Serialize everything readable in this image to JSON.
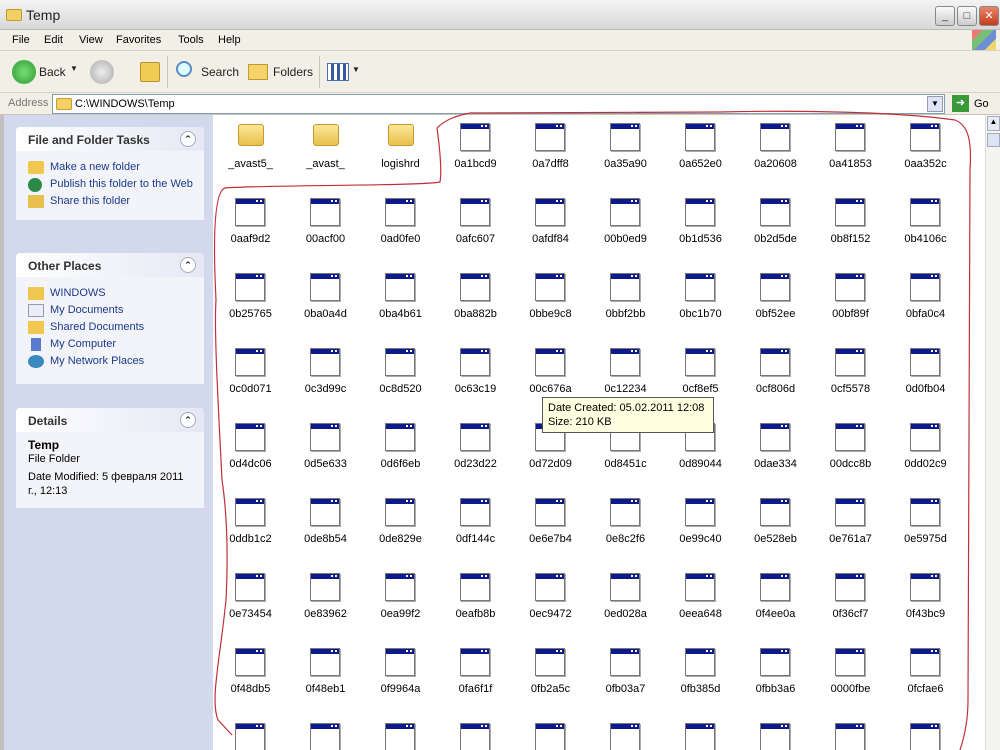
{
  "window": {
    "title": "Temp"
  },
  "menu": [
    "File",
    "Edit",
    "View",
    "Favorites",
    "Tools",
    "Help"
  ],
  "toolbar": {
    "back": "Back",
    "search": "Search",
    "folders": "Folders"
  },
  "address": {
    "label": "Address",
    "value": "C:\\WINDOWS\\Temp",
    "go": "Go"
  },
  "sidebar": {
    "tasks": {
      "title": "File and Folder Tasks",
      "items": [
        "Make a new folder",
        "Publish this folder to the Web",
        "Share this folder"
      ]
    },
    "places": {
      "title": "Other Places",
      "items": [
        "WINDOWS",
        "My Documents",
        "Shared Documents",
        "My Computer",
        "My Network Places"
      ]
    },
    "details": {
      "title": "Details",
      "name": "Temp",
      "type": "File Folder",
      "modified": "Date Modified: 5 февраля 2011 г., 12:13"
    }
  },
  "folders": [
    "_avast5_",
    "_avast_",
    "logishrd"
  ],
  "files": [
    "0a1bcd9",
    "0a7dff8",
    "0a35a90",
    "0a652e0",
    "0a20608",
    "0a41853",
    "0aa352c",
    "0aaf9d2",
    "00acf00",
    "0ad0fe0",
    "0afc607",
    "0afdf84",
    "00b0ed9",
    "0b1d536",
    "0b2d5de",
    "0b8f152",
    "0b4106c",
    "0b25765",
    "0ba0a4d",
    "0ba4b61",
    "0ba882b",
    "0bbe9c8",
    "0bbf2bb",
    "0bc1b70",
    "0bf52ee",
    "00bf89f",
    "0bfa0c4",
    "0c0d071",
    "0c3d99c",
    "0c8d520",
    "0c63c19",
    "00c676a",
    "0c12234",
    "0cf8ef5",
    "0cf806d",
    "0cf5578",
    "0d0fb04",
    "0d4dc06",
    "0d5e633",
    "0d6f6eb",
    "0d23d22",
    "0d72d09",
    "0d8451c",
    "0d89044",
    "0dae334",
    "00dcc8b",
    "0dd02c9",
    "0ddb1c2",
    "0de8b54",
    "0de829e",
    "0df144c",
    "0e6e7b4",
    "0e8c2f6",
    "0e99c40",
    "0e528eb",
    "0e761a7",
    "0e5975d",
    "0e73454",
    "0e83962",
    "0ea99f2",
    "0eafb8b",
    "0ec9472",
    "0ed028a",
    "0eea648",
    "0f4ee0a",
    "0f36cf7",
    "0f43bc9",
    "0f48db5",
    "0f48eb1",
    "0f9964a",
    "0fa6f1f",
    "0fb2a5c",
    "0fb03a7",
    "0fb385d",
    "0fbb3a6",
    "0000fbe",
    "0fcfae6"
  ],
  "tooltip": {
    "line1": "Date Created: 05.02.2011 12:08",
    "line2": "Size: 210 KB"
  }
}
